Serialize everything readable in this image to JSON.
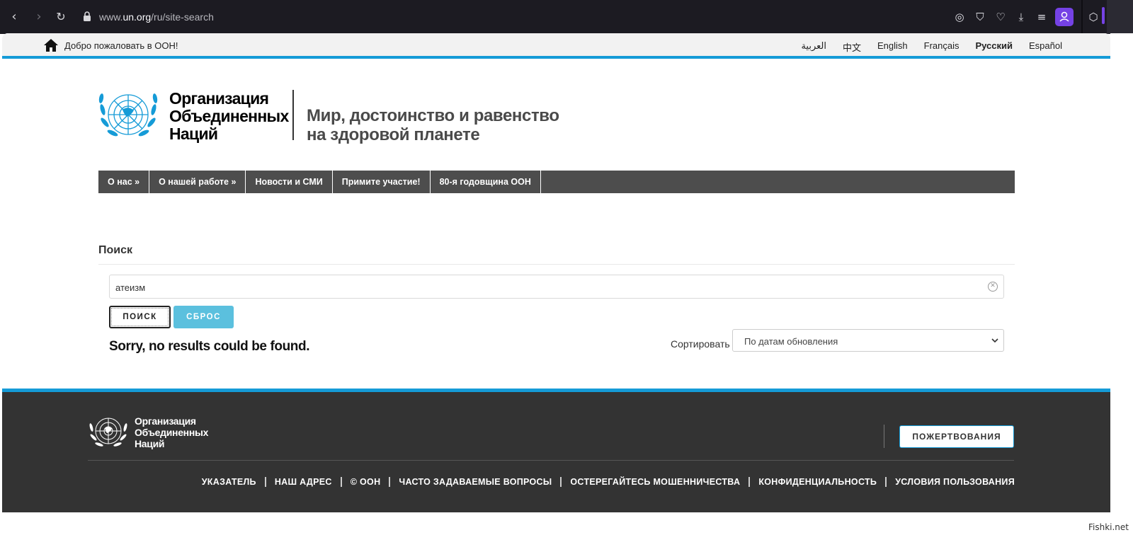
{
  "browser": {
    "url_host": "www.un.org",
    "url_path": "/ru/site-search",
    "nav_icons": [
      "back-icon",
      "forward-icon",
      "reload-icon",
      "lock-icon"
    ],
    "toolbar_icons": [
      "screenshot-icon",
      "shield-icon",
      "heart-icon",
      "download-icon",
      "menu-icon",
      "profile-icon",
      "extension-icon"
    ],
    "accent_color": "#7542e5"
  },
  "topbar": {
    "welcome": "Добро пожаловать в ООН!",
    "languages": [
      {
        "label": "العربية",
        "active": false
      },
      {
        "label": "中文",
        "active": false
      },
      {
        "label": "English",
        "active": false
      },
      {
        "label": "Français",
        "active": false
      },
      {
        "label": "Русский",
        "active": true
      },
      {
        "label": "Español",
        "active": false
      }
    ],
    "accent_color": "#159bd7"
  },
  "header": {
    "org_name_line1": "Организация",
    "org_name_line2": "Объединенных",
    "org_name_line3": "Наций",
    "tagline_line1": "Мир, достоинство и равенство",
    "tagline_line2": "на здоровой планете"
  },
  "mainnav": {
    "items": [
      {
        "label": "О нас »"
      },
      {
        "label": "О нашей работе »"
      },
      {
        "label": "Новости и СМИ"
      },
      {
        "label": "Примите участие!"
      },
      {
        "label": "80-я годовщина ООН"
      }
    ]
  },
  "search": {
    "title": "Поиск",
    "query": "атеизм",
    "search_button": "ПОИСК",
    "reset_button": "СБРОС",
    "no_results": "Sorry, no results could be found.",
    "sort_label": "Сортировать",
    "sort_value": "По датам обновления"
  },
  "footer": {
    "org_name_line1": "Организация",
    "org_name_line2": "Объединенных",
    "org_name_line3": "Наций",
    "donate": "ПОЖЕРТВОВАНИЯ",
    "links": [
      {
        "label": "УКАЗАТЕЛЬ"
      },
      {
        "label": "НАШ АДРЕС"
      },
      {
        "label": "© ООН"
      },
      {
        "label": "ЧАСТО ЗАДАВАЕМЫЕ ВОПРОСЫ"
      },
      {
        "label": "ОСТЕРЕГАЙТЕСЬ МОШЕННИЧЕСТВА"
      },
      {
        "label": "КОНФИДЕНЦИАЛЬНОСТЬ"
      },
      {
        "label": "УСЛОВИЯ ПОЛЬЗОВАНИЯ"
      }
    ]
  },
  "watermark": "Fishki.net"
}
